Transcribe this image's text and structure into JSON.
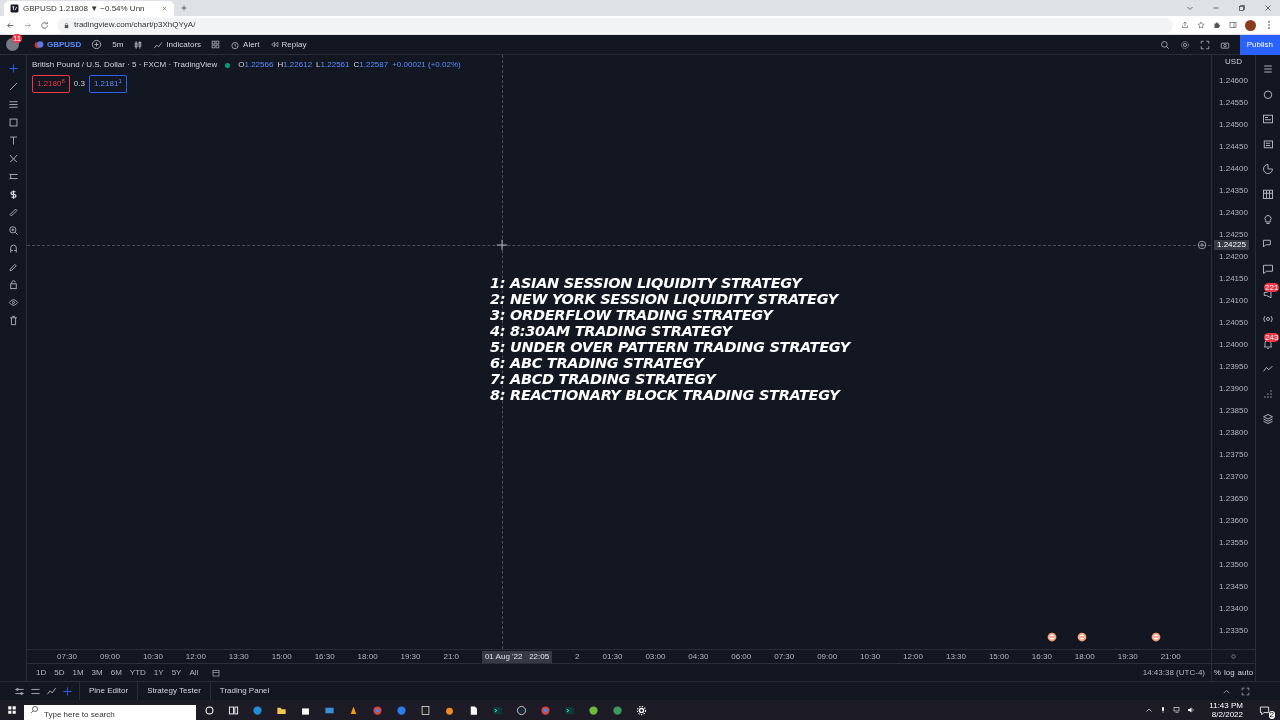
{
  "browser": {
    "tab_title": "GBPUSD 1.21808 ▼ −0.54% Unn",
    "url": "tradingview.com/chart/p3XhQYyA/"
  },
  "toolbar": {
    "badge": "11",
    "symbol": "GBPUSD",
    "interval": "5m",
    "indicators": "Indicators",
    "alert": "Alert",
    "replay": "Replay",
    "publish": "Publish"
  },
  "chart_header": {
    "title": "British Pound / U.S. Dollar · 5 · FXCM · TradingView",
    "ohlc": [
      {
        "label": "O",
        "value": "1.22566"
      },
      {
        "label": "H",
        "value": "1.22612"
      },
      {
        "label": "L",
        "value": "1.22561"
      },
      {
        "label": "C",
        "value": "1.22587"
      }
    ],
    "change": "+0.00021 (+0.02%)",
    "sell": "1.2180$^{8}$",
    "spread": "0.3",
    "buy": "1.2181$^{1}$"
  },
  "overlay_lines": [
    "1: ASIAN SESSION LIQUIDITY STRATEGY",
    "2: NEW YORK SESSION LIQUIDITY STRATEGY",
    "3: ORDERFLOW TRADING STRATEGY",
    "4: 8:30AM TRADING STRATEGY",
    "5: UNDER OVER PATTERN TRADING STRATEGY",
    "6: ABC TRADING STRATEGY",
    "7: ABCD TRADING STRATEGY",
    "8: REACTIONARY BLOCK TRADING STRATEGY"
  ],
  "price_axis": {
    "currency": "USD",
    "crosshair_price": "1.24225",
    "prices": [
      "1.24600",
      "1.24550",
      "1.24500",
      "1.24450",
      "1.24400",
      "1.24350",
      "1.24300",
      "1.24250",
      "1.24200",
      "1.24150",
      "1.24100",
      "1.24050",
      "1.24000",
      "1.23950",
      "1.23900",
      "1.23850",
      "1.23800",
      "1.23750",
      "1.23700",
      "1.23650",
      "1.23600",
      "1.23550",
      "1.23500",
      "1.23450",
      "1.23400",
      "1.23350"
    ]
  },
  "time_axis": {
    "labels": [
      "07:30",
      "09:00",
      "10:30",
      "12:00",
      "13:30",
      "15:00",
      "16:30",
      "18:00",
      "19:30",
      "21:0",
      "2",
      "01:30",
      "03:00",
      "04:30",
      "06:00",
      "07:30",
      "09:00",
      "10:30",
      "12:00",
      "13:30",
      "15:00",
      "16:30",
      "18:00",
      "19:30",
      "21:00"
    ],
    "crosshair_time": "01 Aug '22   22:05"
  },
  "ranges": [
    "1D",
    "5D",
    "1M",
    "3M",
    "6M",
    "YTD",
    "1Y",
    "5Y",
    "All"
  ],
  "status": {
    "clock": "14:43:38 (UTC-4)",
    "options": [
      "%",
      "log",
      "auto"
    ]
  },
  "bottom_tabs": [
    "Pine Editor",
    "Strategy Tester",
    "Trading Panel"
  ],
  "right_sidebar": {
    "ideas_badge": "221",
    "notifications_badge": "243"
  },
  "taskbar": {
    "search_placeholder": "Type here to search",
    "time": "11:43 PM",
    "date": "8/2/2022",
    "notifications": "2"
  }
}
